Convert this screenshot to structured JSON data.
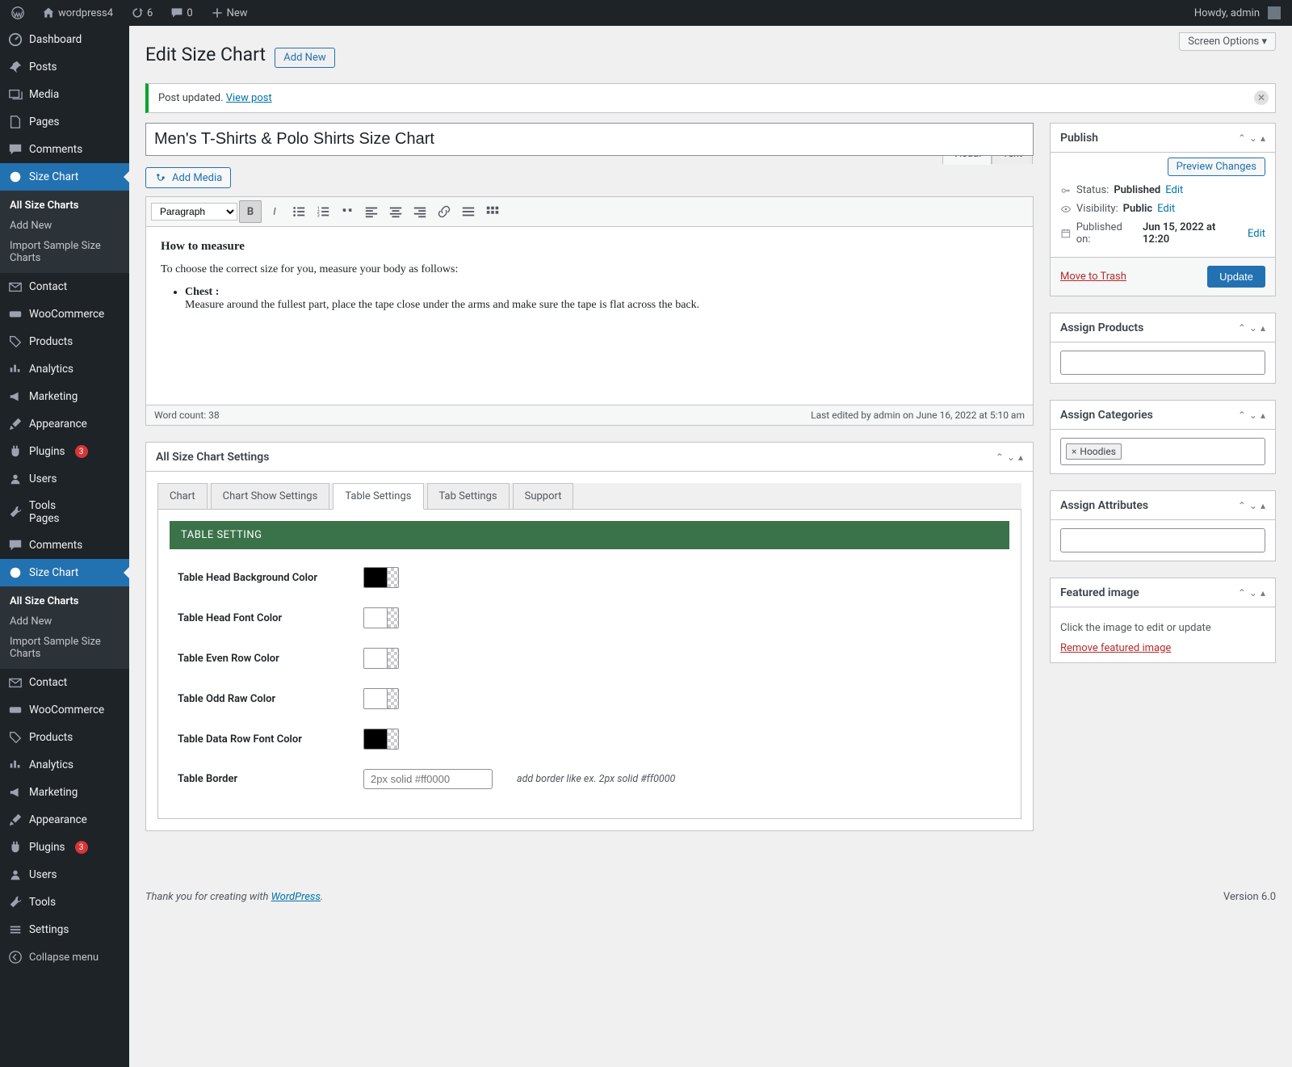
{
  "adminbar": {
    "site": "wordpress4",
    "updates": "6",
    "comments": "0",
    "new": "New",
    "howdy": "Howdy, admin"
  },
  "sidebar": {
    "dashboard": "Dashboard",
    "posts": "Posts",
    "media": "Media",
    "pages": "Pages",
    "comments": "Comments",
    "size_chart": "Size Chart",
    "sub_all": "All Size Charts",
    "sub_add": "Add New",
    "sub_import": "Import Sample Size Charts",
    "contact": "Contact",
    "woocommerce": "WooCommerce",
    "products": "Products",
    "analytics": "Analytics",
    "marketing": "Marketing",
    "appearance": "Appearance",
    "plugins": "Plugins",
    "plugins_count": "3",
    "users": "Users",
    "tools": "Tools",
    "settings": "Settings",
    "collapse": "Collapse menu"
  },
  "header": {
    "screen_options": "Screen Options",
    "title": "Edit Size Chart",
    "add_new": "Add New"
  },
  "notice": {
    "text": "Post updated. ",
    "link": "View post"
  },
  "post": {
    "title": "Men's T-Shirts & Polo Shirts Size Chart",
    "add_media": "Add Media",
    "visual": "Visual",
    "text": "Text",
    "paragraph": "Paragraph",
    "body_h": "How to measure",
    "body_p": "To choose the correct size for you, measure your body as follows:",
    "body_li_b": "Chest :",
    "body_li": "Measure around the fullest part, place the tape close under the arms and make sure the tape is flat across the back.",
    "word_count": "Word count: 38",
    "last_edited": "Last edited by admin on June 16, 2022 at 5:10 am"
  },
  "metabox": {
    "title": "All Size Chart Settings",
    "tabs": {
      "chart": "Chart",
      "show": "Chart Show Settings",
      "table": "Table Settings",
      "tab": "Tab Settings",
      "support": "Support"
    },
    "section": "TABLE SETTING",
    "head_bg": "Table Head Background Color",
    "head_font": "Table Head Font Color",
    "even": "Table Even Row Color",
    "odd": "Table Odd Raw Color",
    "data_font": "Table Data Row Font Color",
    "border": "Table Border",
    "border_ph": "2px solid #ff0000",
    "border_hint": "add border like ex. 2px solid #ff0000",
    "colors": {
      "head_bg": "#000000",
      "head_font": "#ffffff",
      "even": "#ffffff",
      "odd": "#ffffff",
      "data_font": "#000000"
    }
  },
  "publish": {
    "title": "Publish",
    "preview": "Preview Changes",
    "status_label": "Status:",
    "status": "Published",
    "edit": "Edit",
    "visibility_label": "Visibility:",
    "visibility": "Public",
    "published_label": "Published on:",
    "published": "Jun 15, 2022 at 12:20",
    "trash": "Move to Trash",
    "update": "Update"
  },
  "assign_products": {
    "title": "Assign Products"
  },
  "assign_categories": {
    "title": "Assign Categories",
    "tag": "Hoodies"
  },
  "assign_attributes": {
    "title": "Assign Attributes"
  },
  "featured": {
    "title": "Featured image",
    "hint": "Click the image to edit or update",
    "remove": "Remove featured image"
  },
  "footer": {
    "thank": "Thank you for creating with ",
    "wp": "WordPress",
    "version": "Version 6.0"
  }
}
